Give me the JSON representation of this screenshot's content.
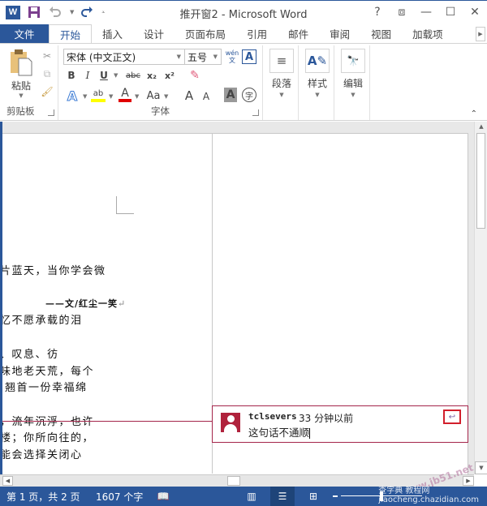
{
  "window": {
    "title": "推开窗2 - Microsoft Word",
    "controls": {
      "help": "?",
      "ribbon_display": "⧈",
      "minimize": "—",
      "maximize": "☐",
      "close": "✕"
    }
  },
  "qat": {
    "app_icon": "W",
    "save": "save-icon",
    "undo": "undo-icon",
    "redo": "redo-icon",
    "customize": "customize-icon"
  },
  "tabs": [
    {
      "label": "文件"
    },
    {
      "label": "开始"
    },
    {
      "label": "插入"
    },
    {
      "label": "设计"
    },
    {
      "label": "页面布局"
    },
    {
      "label": "引用"
    },
    {
      "label": "邮件"
    },
    {
      "label": "审阅"
    },
    {
      "label": "视图"
    },
    {
      "label": "加载项"
    }
  ],
  "ribbon": {
    "clipboard": {
      "paste_label": "粘贴",
      "group_label": "剪贴板"
    },
    "font": {
      "font_name": "宋体 (中文正文)",
      "font_size": "五号",
      "pinyin": "wén\n文",
      "border_char": "A",
      "bold": "B",
      "italic": "I",
      "underline": "U",
      "strike": "abc",
      "subscript": "x₂",
      "superscript": "x²",
      "text_effects": "A",
      "highlight": "ab",
      "font_color": "A",
      "change_case": "Aa",
      "grow": "A",
      "shrink": "A",
      "shading": "A",
      "enclose": "字",
      "group_label": "字体"
    },
    "paragraph": {
      "label": "段落"
    },
    "styles": {
      "label": "样式"
    },
    "editing": {
      "label": "编辑"
    }
  },
  "document": {
    "lines": [
      "片蓝天，当你学会微",
      "——文/红尘一笑",
      "忆不愿承载的泪",
      "、叹息、彷",
      "味地老天荒，每个",
      "翘首一份幸福绵",
      "，流年沉浮，也许",
      "楼；你所向往的，",
      "能会选择关闭心"
    ]
  },
  "comment": {
    "author": "tclsevers",
    "time": "33 分钟以前",
    "text": "这句话不通顺",
    "highlight_color": "#a4254a"
  },
  "statusbar": {
    "page": "第 1 页，共 2 页",
    "words": "1607 个字",
    "proofing": "proofing-icon",
    "zoom_percent": "100%"
  },
  "watermark": {
    "line1": "查字典 教程网",
    "line2": "jiaocheng.chazidian.com",
    "site": "www.jb51.net"
  },
  "colors": {
    "accent": "#2b579a",
    "comment": "#a4254a",
    "reply_highlight": "#d21f2c"
  }
}
